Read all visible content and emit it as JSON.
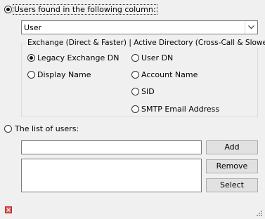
{
  "mode_options": {
    "column_label": "Users found in the following column:",
    "list_label": "The list of users:"
  },
  "column_select": {
    "value": "User"
  },
  "groupbox": {
    "title": "Exchange (Direct & Faster) | Active Directory (Cross-Call & Slower)",
    "options": [
      "Legacy Exchange DN",
      "Display Name",
      "User DN",
      "Account Name",
      "SID",
      "SMTP Email Address"
    ]
  },
  "list": {
    "input_value": "",
    "add_label": "Add",
    "remove_label": "Remove",
    "select_label": "Select"
  },
  "icons": {
    "close": "close-icon",
    "grip": "resize-grip-icon"
  }
}
